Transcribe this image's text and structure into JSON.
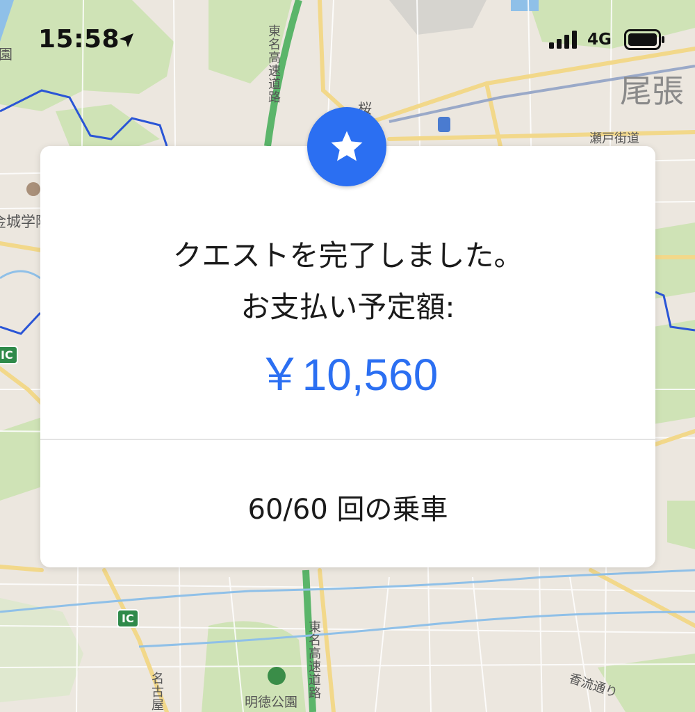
{
  "status_bar": {
    "time": "15:58",
    "network": "4G",
    "icons": [
      "location-arrow-icon",
      "signal-icon",
      "battery-icon"
    ]
  },
  "map": {
    "labels": {
      "owari": "尾張",
      "seto_kaido": "瀬戸街道",
      "sakura": "桜",
      "kinjo": "金城学院",
      "tomei_top": "東名高速道路",
      "tomei_bottom": "東名高速道路",
      "meitoku_park": "明徳公園",
      "koryu_dori": "香流通り",
      "nagoya": "名古屋",
      "en": "園",
      "ic1": "IC",
      "ic2": "IC"
    }
  },
  "quest": {
    "line1": "クエストを完了しました。",
    "line2": "お支払い予定額:",
    "amount": "￥10,560",
    "rides": "60/60 回の乗車",
    "badge_icon": "star-icon"
  },
  "colors": {
    "accent": "#2b6ff2",
    "card_bg": "#ffffff"
  }
}
